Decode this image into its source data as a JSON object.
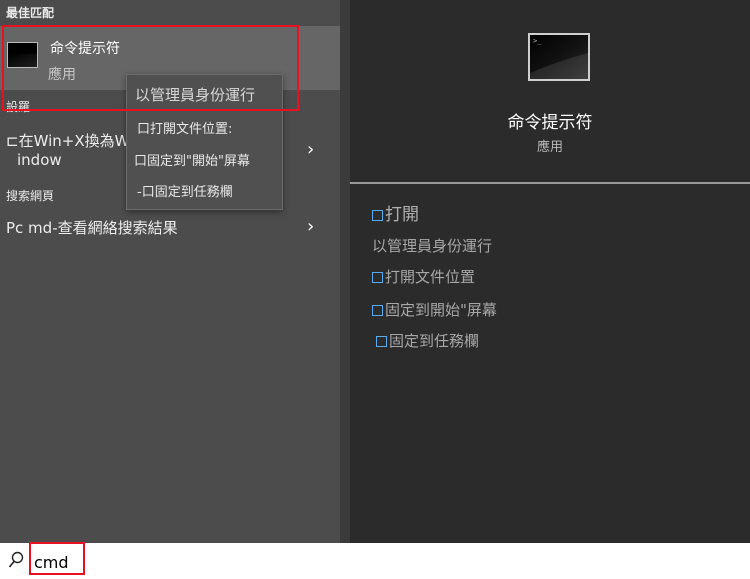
{
  "sections": {
    "best_match": "最佳匹配",
    "settings": "設羅",
    "web": "搜索網頁"
  },
  "best_match": {
    "title": "命令提示符",
    "subtitle": "應用"
  },
  "settings_item": {
    "line1": "⊏在Win+X換為W",
    "line2": "indow"
  },
  "web_item": {
    "label": "Pc md-查看網絡搜索結果"
  },
  "context_menu": {
    "items": [
      "以管理員身份運行",
      "口打開文件位置:",
      "口固定到\"開始\"屏幕",
      "-口固定到任務欄"
    ]
  },
  "preview": {
    "title": "命令提示符",
    "subtitle": "應用",
    "actions": [
      {
        "label": "打開",
        "box": true
      },
      {
        "label": "以管理員身份運行",
        "box": false
      },
      {
        "label": "打開文件位置",
        "box": true
      },
      {
        "label": "固定到開始\"屏幕",
        "box": true
      },
      {
        "label": "固定到任務欄",
        "box": true
      }
    ]
  },
  "search": {
    "value": "cmd",
    "icon": "search-icon"
  },
  "colors": {
    "highlight": "#e81123",
    "accent": "#5aaaf0"
  }
}
